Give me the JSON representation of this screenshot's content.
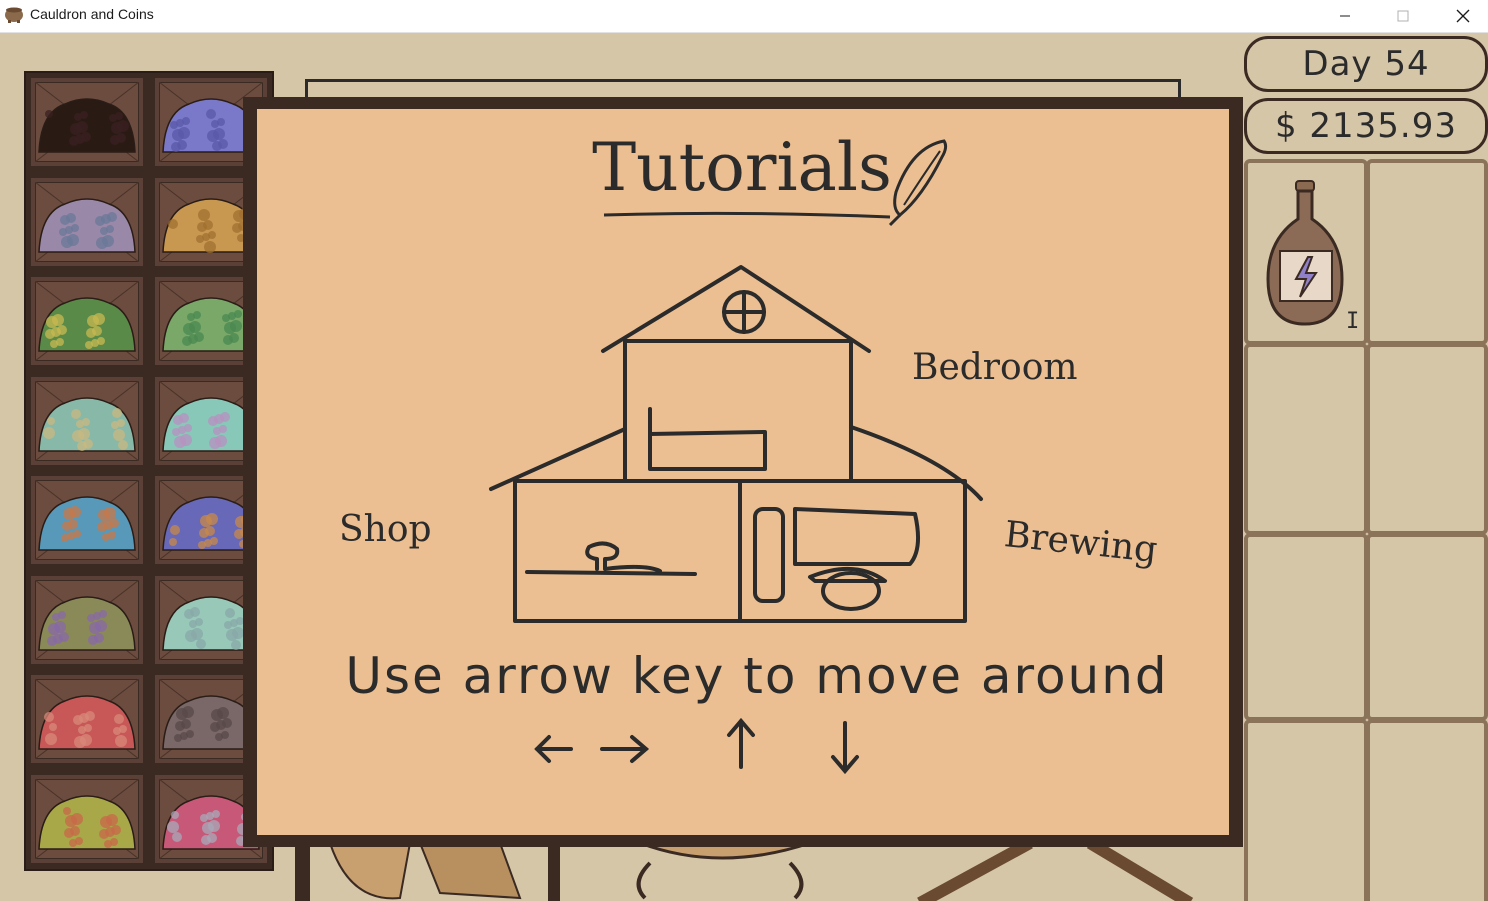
{
  "window": {
    "title": "Cauldron and Coins",
    "controls": [
      "minimize",
      "maximize",
      "close"
    ]
  },
  "hud": {
    "day": "Day 54",
    "money": "$ 2135.93"
  },
  "modal": {
    "title": "Tutorials",
    "rooms": {
      "bedroom": "Bedroom",
      "shop": "Shop",
      "brewing": "Brewing"
    },
    "instruction": "Use arrow key to move around",
    "arrow_keys": [
      "left-arrow-icon",
      "right-arrow-icon",
      "up-arrow-icon",
      "down-arrow-icon"
    ]
  },
  "inventory": {
    "items": [
      {
        "name": "energy-potion-icon",
        "hotkey": "I"
      }
    ]
  },
  "ingredients": [
    {
      "color": "#2a1a14",
      "accent": "#3a2020"
    },
    {
      "color": "#7a78c8",
      "accent": "#5a58a8"
    },
    {
      "color": "#9a88a8",
      "accent": "#6a7898"
    },
    {
      "color": "#c89850",
      "accent": "#a07030"
    },
    {
      "color": "#5a8a48",
      "accent": "#c8b850"
    },
    {
      "color": "#7aa868",
      "accent": "#4a8850"
    },
    {
      "color": "#88b8a8",
      "accent": "#c8b880"
    },
    {
      "color": "#88c8b8",
      "accent": "#b890c0"
    },
    {
      "color": "#5898b8",
      "accent": "#c87848"
    },
    {
      "color": "#6868b8",
      "accent": "#c88848"
    },
    {
      "color": "#8a8a58",
      "accent": "#8868a8"
    },
    {
      "color": "#98c8b8",
      "accent": "#88a8a8"
    },
    {
      "color": "#c85858",
      "accent": "#d88878"
    },
    {
      "color": "#7a6868",
      "accent": "#5a4848"
    },
    {
      "color": "#a8a848",
      "accent": "#c86848"
    },
    {
      "color": "#c85878",
      "accent": "#a8a8b8"
    }
  ],
  "colors": {
    "background": "#d6c6a8",
    "modal_frame": "#3a2a22",
    "modal_paper": "#ecbf92",
    "ink": "#2b2b2b",
    "inventory_border": "#8b735a"
  }
}
